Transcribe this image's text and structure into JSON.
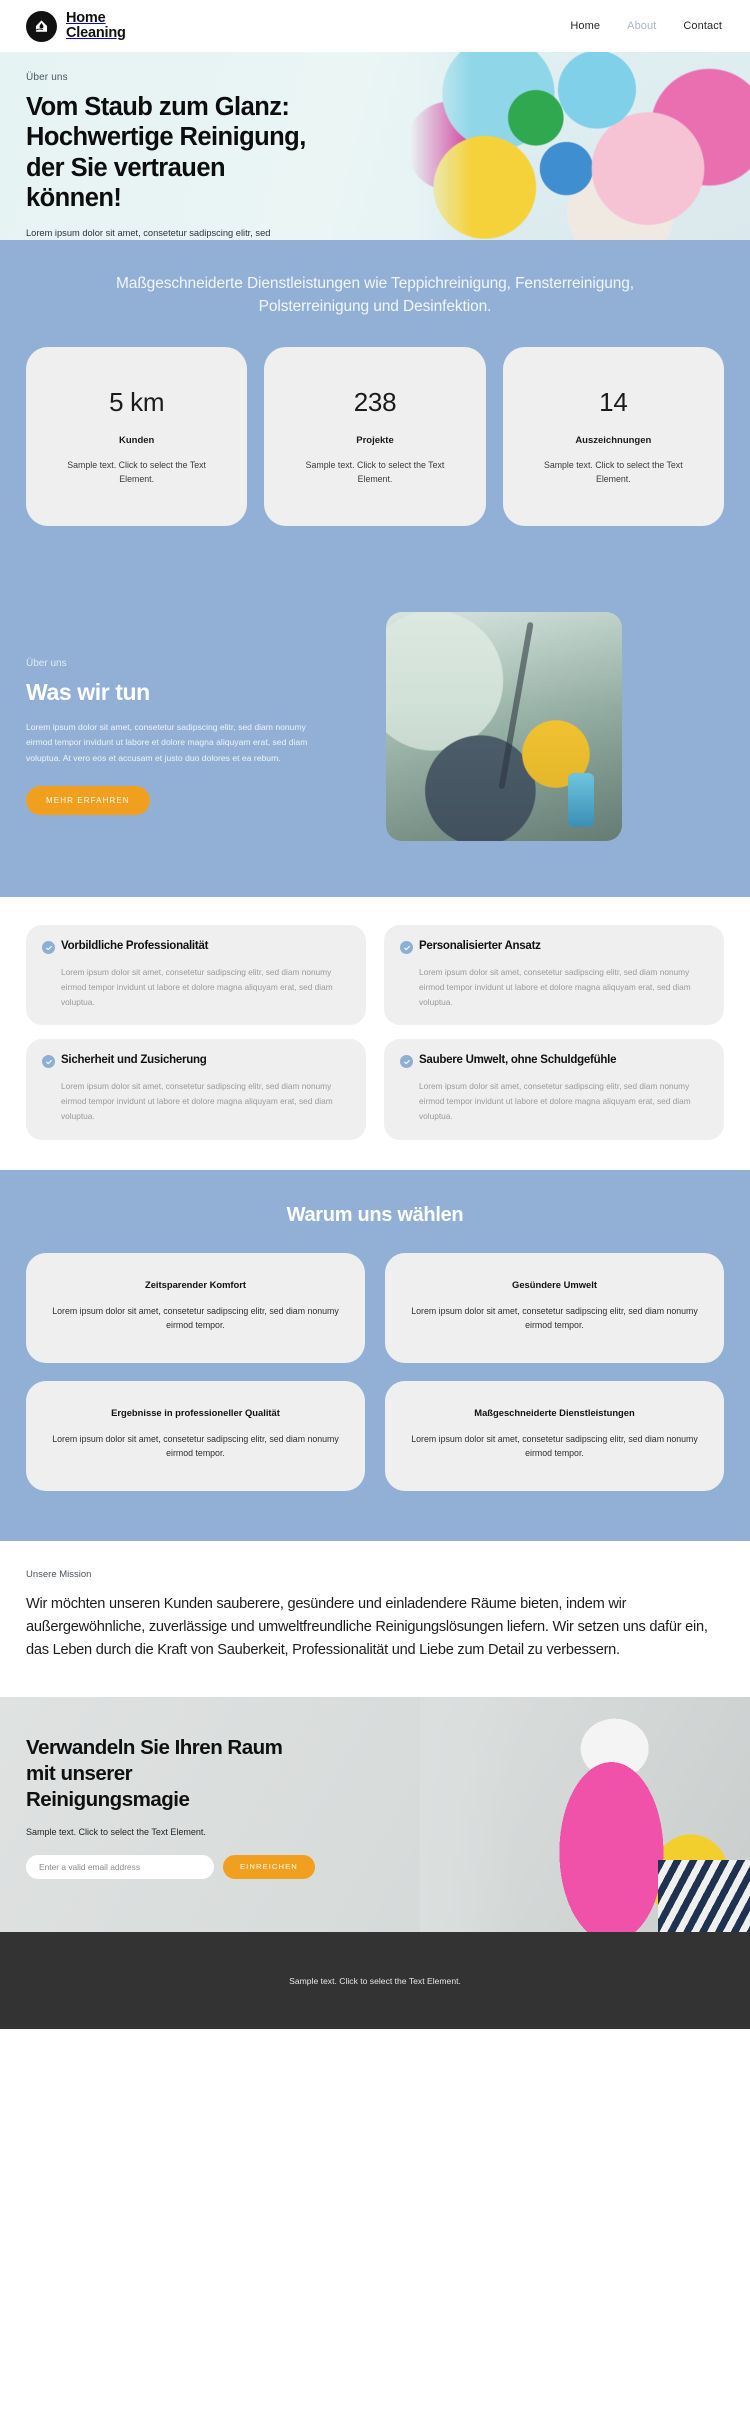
{
  "header": {
    "logo_icon": "house-droplet-logo-icon",
    "brand_name": "Home\nCleaning",
    "nav": [
      {
        "label": "Home",
        "state": "default"
      },
      {
        "label": "About",
        "state": "muted"
      },
      {
        "label": "Contact",
        "state": "default"
      }
    ]
  },
  "hero": {
    "eyebrow": "Über uns",
    "title": "Vom Staub zum Glanz: Hochwertige Reinigung, der Sie vertrauen können!",
    "body": "Lorem ipsum dolor sit amet, consetetur sadipscing elitr, sed diam nonumy eirmod tempor invidunt ut labore et dolore magna aliquyam erat, sed diam voluptua.",
    "image_alt": "cleaning-supplies-bucket-photo"
  },
  "services": {
    "headline": "Maßgeschneiderte Dienstleistungen wie Teppichreinigung, Fensterreinigung, Polsterreinigung und Desinfektion.",
    "stats": [
      {
        "number": "5 km",
        "label": "Kunden",
        "text": "Sample text. Click to select the Text Element."
      },
      {
        "number": "238",
        "label": "Projekte",
        "text": "Sample text. Click to select the Text Element."
      },
      {
        "number": "14",
        "label": "Auszeichnungen",
        "text": "Sample text. Click to select the Text Element."
      }
    ]
  },
  "about": {
    "eyebrow": "Über uns",
    "title": "Was wir tun",
    "body": "Lorem ipsum dolor sit amet, consetetur sadipscing elitr, sed diam nonumy eirmod tempor invidunt ut labore et dolore magna aliquyam erat, sed diam voluptua. At vero eos et accusam et justo duo dolores et ea rebum.",
    "button_label": "MEHR ERFAHREN",
    "image_alt": "window-cleaning-squeegee-photo"
  },
  "features": [
    {
      "title": "Vorbildliche Professionalität",
      "text": "Lorem ipsum dolor sit amet, consetetur sadipscing elitr, sed diam nonumy eirmod tempor invidunt ut labore et dolore magna aliquyam erat, sed diam voluptua."
    },
    {
      "title": "Personalisierter Ansatz",
      "text": "Lorem ipsum dolor sit amet, consetetur sadipscing elitr, sed diam nonumy eirmod tempor invidunt ut labore et dolore magna aliquyam erat, sed diam voluptua."
    },
    {
      "title": "Sicherheit und Zusicherung",
      "text": "Lorem ipsum dolor sit amet, consetetur sadipscing elitr, sed diam nonumy eirmod tempor invidunt ut labore et dolore magna aliquyam erat, sed diam voluptua."
    },
    {
      "title": "Saubere Umwelt, ohne Schuldgefühle",
      "text": "Lorem ipsum dolor sit amet, consetetur sadipscing elitr, sed diam nonumy eirmod tempor invidunt ut labore et dolore magna aliquyam erat, sed diam voluptua."
    }
  ],
  "why": {
    "title": "Warum uns wählen",
    "cards": [
      {
        "title": "Zeitsparender Komfort",
        "text": "Lorem ipsum dolor sit amet, consetetur sadipscing elitr, sed diam nonumy eirmod tempor."
      },
      {
        "title": "Gesündere Umwelt",
        "text": "Lorem ipsum dolor sit amet, consetetur sadipscing elitr, sed diam nonumy eirmod tempor."
      },
      {
        "title": "Ergebnisse in professioneller Qualität",
        "text": "Lorem ipsum dolor sit amet, consetetur sadipscing elitr, sed diam nonumy eirmod tempor."
      },
      {
        "title": "Maßgeschneiderte Dienstleistungen",
        "text": "Lorem ipsum dolor sit amet, consetetur sadipscing elitr, sed diam nonumy eirmod tempor."
      }
    ]
  },
  "mission": {
    "eyebrow": "Unsere Mission",
    "text": "Wir möchten unseren Kunden sauberere, gesündere und einladendere Räume bieten, indem wir außergewöhnliche, zuverlässige und umweltfreundliche Reinigungslösungen liefern. Wir setzen uns dafür ein, das Leben durch die Kraft von Sauberkeit, Professionalität und Liebe zum Detail zu verbessern."
  },
  "cta": {
    "title": "Verwandeln Sie Ihren Raum mit unserer Reinigungsmagie",
    "subtitle": "Sample text. Click to select the Text Element.",
    "email_placeholder": "Enter a valid email address",
    "email_value": "",
    "submit_label": "EINREICHEN",
    "image_alt": "spray-bottle-yellow-glove-photo"
  },
  "footer": {
    "text": "Sample text. Click to select the Text Element."
  },
  "colors": {
    "brand_blue": "#92b0d6",
    "accent_orange": "#f0a01e",
    "card_gray": "#efefef",
    "footer_dark": "#333333",
    "check_blue": "#8eafd4"
  }
}
